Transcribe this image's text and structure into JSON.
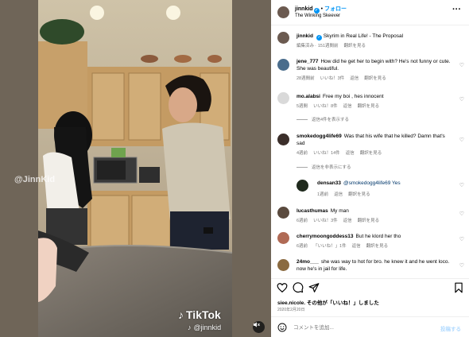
{
  "media": {
    "left_watermark": "@JinnKid",
    "tiktok_label": "TikTok",
    "tiktok_user": "@jinnkid",
    "mute_icon": "speaker-muted-icon"
  },
  "header": {
    "username": "jinnkid",
    "separator": "•",
    "follow_label": "フォロー",
    "subtitle": "The Winking Skeever",
    "more_icon": "more-dots-icon"
  },
  "caption": {
    "username": "jinnkid",
    "text": "Skyrim in Real Life! - The Proposal",
    "edited": "編集済み",
    "time": "151週間前",
    "translate": "翻訳を見る"
  },
  "comments": [
    {
      "username": "jene_777",
      "text": "How did he get her to begin with? He's not funny or cute. She was beautiful.",
      "time": "28週間前",
      "likes": "いいね！3件",
      "reply": "返信",
      "translate": "翻訳を見る"
    },
    {
      "username": "mo.alabsi",
      "text": "Free my boi , hes innocent",
      "time": "5週間",
      "likes": "いいね！8件",
      "reply": "返信",
      "translate": "翻訳を見る",
      "replies_label": "返信4件を表示する"
    },
    {
      "username": "smokedogg4life69",
      "text": "Was that his wife that he killed? Damn that's sad",
      "time": "4週前",
      "likes": "いいね！14件",
      "reply": "返信",
      "translate": "翻訳を見る",
      "replies_label": "返信を非表示にする"
    },
    {
      "username": "densan33",
      "text": "@smokedogg4life69 Yes",
      "time": "1週前",
      "reply": "返信",
      "translate": "翻訳を見る"
    },
    {
      "username": "lucasthumas",
      "text": "My man",
      "time": "6週前",
      "likes": "いいね！3件",
      "reply": "返信",
      "translate": "翻訳を見る"
    },
    {
      "username": "cherrymoongoddess13",
      "text": "But he klord her tho",
      "time": "6週前",
      "likes": "「いいね！」1件",
      "reply": "返信",
      "translate": "翻訳を見る"
    },
    {
      "username": "24mo___",
      "text": "she was way to hot for bro. he knew it and he went loco. now he's in jail for life."
    }
  ],
  "actions": {
    "like_icon": "heart-icon",
    "comment_icon": "comment-bubble-icon",
    "share_icon": "paper-plane-icon",
    "save_icon": "bookmark-icon"
  },
  "likes": {
    "user": "siee.nicole.",
    "text": "その他が「いいね！」しました"
  },
  "post_date": "2020年2月20日",
  "add_comment": {
    "placeholder": "コメントを追加...",
    "post_label": "投稿する",
    "emoji_icon": "emoji-smile-icon"
  },
  "colors": {
    "accent": "#0095f6",
    "meta": "#737373",
    "post_disabled": "#b3dbff"
  }
}
